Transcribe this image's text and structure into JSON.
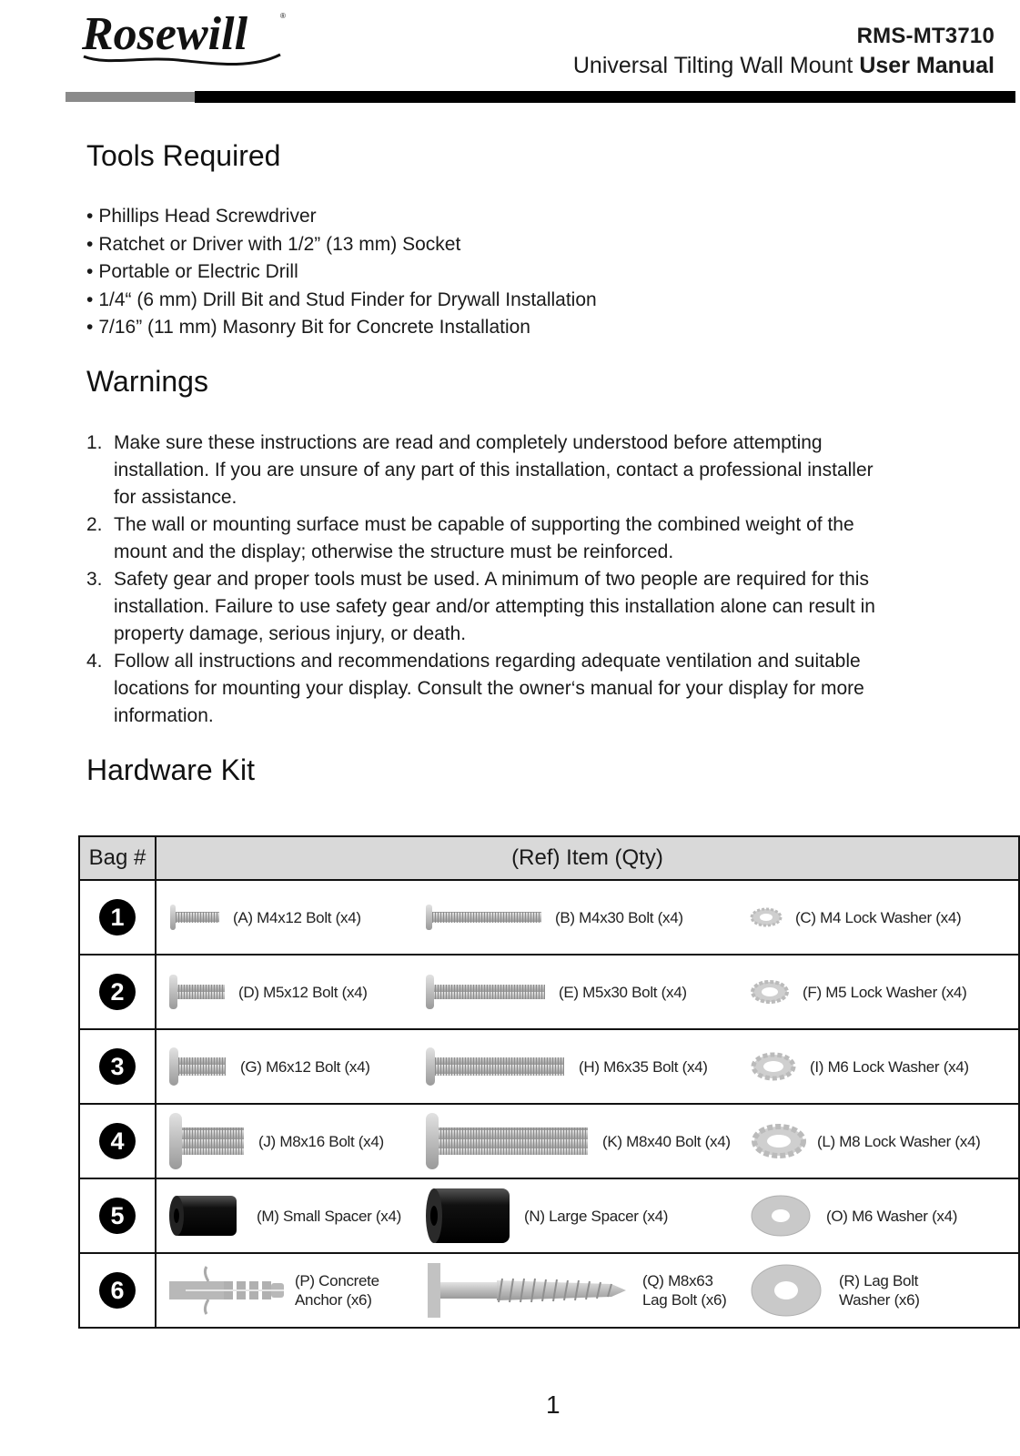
{
  "header": {
    "brand": "Rosewill",
    "registered_mark": "®",
    "model": "RMS-MT3710",
    "subtitle_regular": "Universal Tilting Wall Mount ",
    "subtitle_bold": "User Manual"
  },
  "tools": {
    "heading": "Tools Required",
    "items": [
      "Phillips Head Screwdriver",
      "Ratchet or Driver with 1/2” (13 mm) Socket",
      "Portable or Electric Drill",
      "1/4“ (6 mm) Drill Bit and Stud Finder for Drywall Installation",
      "7/16”  (11 mm) Masonry Bit for Concrete Installation"
    ]
  },
  "warnings": {
    "heading": "Warnings",
    "items": [
      {
        "num": "1.",
        "text": "Make sure these instructions are read and completely understood before attempting installation. If you are unsure of any part of this installation, contact a professional installer for assistance."
      },
      {
        "num": "2.",
        "text": "The wall or mounting surface must be capable of supporting the combined weight of the mount and the display; otherwise the structure must be reinforced."
      },
      {
        "num": "3.",
        "text": "Safety gear and proper tools must be used. A minimum of two people are required for this installation. Failure to use safety gear and/or attempting this installation alone can result in property damage, serious injury, or death."
      },
      {
        "num": "4.",
        "text": "Follow all instructions and recommendations regarding adequate ventilation and suitable locations for mounting your display. Consult the owner‘s manual for your display for more information."
      }
    ]
  },
  "hardware": {
    "heading": "Hardware Kit",
    "col_bag": "Bag #",
    "col_item": "(Ref) Item (Qty)",
    "rows": [
      {
        "bag": "1",
        "items": [
          {
            "icon": "short-bolt-icon",
            "label": "(A) M4x12 Bolt (x4)"
          },
          {
            "icon": "long-bolt-icon",
            "label": "(B) M4x30 Bolt (x4)"
          },
          {
            "icon": "lock-washer-icon",
            "label": "(C) M4 Lock Washer (x4)"
          }
        ]
      },
      {
        "bag": "2",
        "items": [
          {
            "icon": "short-bolt-icon",
            "label": "(D) M5x12 Bolt (x4)"
          },
          {
            "icon": "long-bolt-icon",
            "label": "(E) M5x30 Bolt (x4)"
          },
          {
            "icon": "lock-washer-icon",
            "label": "(F) M5 Lock Washer (x4)"
          }
        ]
      },
      {
        "bag": "3",
        "items": [
          {
            "icon": "short-bolt-icon",
            "label": "(G) M6x12 Bolt (x4)"
          },
          {
            "icon": "long-bolt-icon",
            "label": "(H) M6x35 Bolt (x4)"
          },
          {
            "icon": "lock-washer-icon",
            "label": "(I) M6 Lock Washer (x4)"
          }
        ]
      },
      {
        "bag": "4",
        "items": [
          {
            "icon": "short-bolt-icon",
            "label": "(J) M8x16 Bolt (x4)"
          },
          {
            "icon": "long-bolt-icon",
            "label": "(K) M8x40 Bolt (x4)"
          },
          {
            "icon": "lock-washer-icon",
            "label": "(L) M8 Lock Washer (x4)"
          }
        ]
      },
      {
        "bag": "5",
        "items": [
          {
            "icon": "small-spacer-icon",
            "label": "(M) Small Spacer (x4)"
          },
          {
            "icon": "large-spacer-icon",
            "label": "(N) Large Spacer (x4)"
          },
          {
            "icon": "flat-washer-icon",
            "label": "(O) M6 Washer (x4)"
          }
        ]
      },
      {
        "bag": "6",
        "items": [
          {
            "icon": "concrete-anchor-icon",
            "label_line1": "(P) Concrete",
            "label_line2": "Anchor (x6)"
          },
          {
            "icon": "lag-bolt-icon",
            "label_line1": "(Q) M8x63",
            "label_line2": "Lag Bolt (x6)"
          },
          {
            "icon": "flat-washer-icon",
            "label_line1": "(R) Lag Bolt",
            "label_line2": "Washer (x6)"
          }
        ]
      }
    ]
  },
  "footer": {
    "page_number": "1"
  }
}
